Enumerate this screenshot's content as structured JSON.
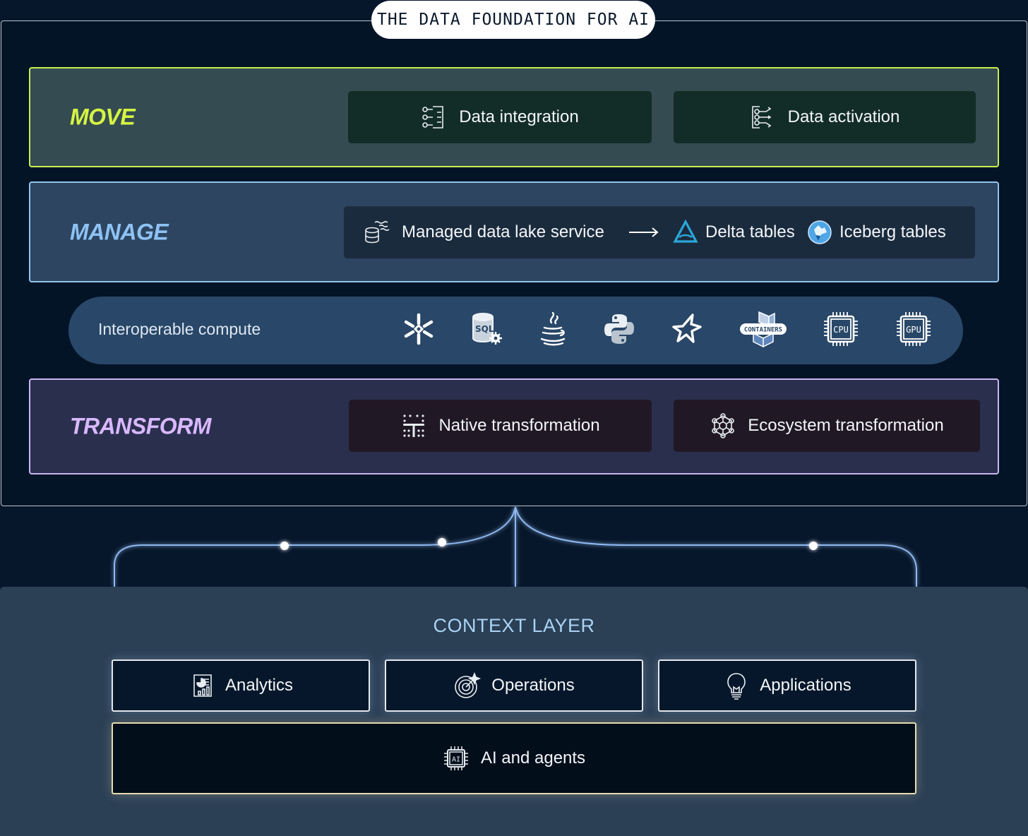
{
  "header": {
    "badge": "THE DATA FOUNDATION FOR AI"
  },
  "move": {
    "title": "MOVE",
    "cards": [
      {
        "label": "Data integration",
        "icon": "data-integration-icon"
      },
      {
        "label": "Data activation",
        "icon": "data-activation-icon"
      }
    ]
  },
  "manage": {
    "title": "MANAGE",
    "service": {
      "label": "Managed data lake service",
      "icon": "data-lake-icon"
    },
    "arrow_icon": "arrow-right-icon",
    "formats": [
      {
        "label": "Delta tables",
        "icon": "delta-lake-icon"
      },
      {
        "label": "Iceberg tables",
        "icon": "iceberg-icon"
      }
    ]
  },
  "compute": {
    "label": "Interoperable compute",
    "icons": [
      "snowflake-icon",
      "sql-icon",
      "java-icon",
      "python-icon",
      "star-icon",
      "containers-icon",
      "cpu-icon",
      "gpu-icon"
    ],
    "icon_text": {
      "containers": "CONTAINERS",
      "cpu": "CPU",
      "gpu": "GPU",
      "sql": "SQL"
    }
  },
  "transform": {
    "title": "TRANSFORM",
    "cards": [
      {
        "label": "Native transformation",
        "icon": "native-transformation-icon"
      },
      {
        "label": "Ecosystem transformation",
        "icon": "ecosystem-icon"
      }
    ]
  },
  "context": {
    "title": "CONTEXT LAYER",
    "cards": [
      {
        "label": "Analytics",
        "icon": "analytics-icon"
      },
      {
        "label": "Operations",
        "icon": "operations-icon"
      },
      {
        "label": "Applications",
        "icon": "lightbulb-icon"
      }
    ],
    "ai": {
      "label": "AI and agents",
      "icon": "ai-chip-icon",
      "chip_text": "AI"
    }
  },
  "colors": {
    "background": "#07172b",
    "move_accent": "#d6f542",
    "manage_accent": "#8ec2f5",
    "transform_accent": "#d9b8ff",
    "context_title": "#a9d3f3",
    "connector": "#8fb8f0"
  }
}
